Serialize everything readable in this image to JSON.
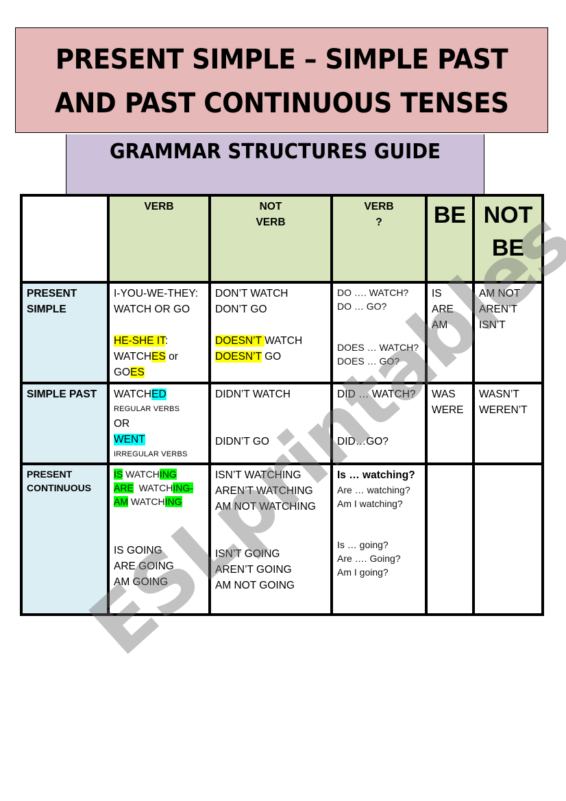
{
  "title": {
    "line1": "PRESENT SIMPLE – SIMPLE PAST",
    "line2": "AND PAST CONTINUOUS TENSES"
  },
  "subtitle": "GRAMMAR STRUCTURES GUIDE",
  "watermark": "ESLprintables.com",
  "colors": {
    "title_bg": "#e6b8b7",
    "subtitle_bg": "#ccc0da",
    "header_bg": "#d7e4bc",
    "row_label_bg": "#dbeef4",
    "highlight_yellow": "#ffff00",
    "highlight_cyan": "#00ffff",
    "highlight_green": "#00ff00"
  },
  "table": {
    "headers": [
      {
        "lines": [
          "VERB"
        ]
      },
      {
        "lines": [
          "NOT",
          "VERB"
        ]
      },
      {
        "lines": [
          "VERB",
          "?"
        ]
      },
      {
        "lines": [
          "BE"
        ]
      },
      {
        "lines": [
          "NOT",
          "BE"
        ]
      }
    ],
    "rows": [
      {
        "label": [
          "PRESENT",
          "SIMPLE"
        ],
        "verb": {
          "line1": "I-YOU-WE-THEY:",
          "line2": "WATCH OR GO",
          "he_she_it_hl": "HE-SHE IT",
          "he_she_it_rest": ":",
          "watches_base": "WATCH",
          "watches_hl": "ES",
          "watches_rest": " or",
          "goes_base": "GO",
          "goes_hl": "ES"
        },
        "not_verb": {
          "line1": "DON’T  WATCH",
          "line2": "DON’T GO",
          "doesnt1_hl": "DOESN’T ",
          "doesnt1_rest": " WATCH",
          "doesnt2_hl": "DOESN’T",
          "doesnt2_rest": " GO"
        },
        "verb_q": [
          "DO …. WATCH?",
          "DO … GO?",
          "DOES … WATCH?",
          "DOES … GO?"
        ],
        "be": [
          "IS",
          "ARE",
          "AM"
        ],
        "not_be": [
          "AM NOT",
          "AREN’T",
          "ISN’T"
        ]
      },
      {
        "label": [
          "SIMPLE PAST"
        ],
        "verb": {
          "watched_base": "WATCH",
          "watched_hl": "ED",
          "regular": "REGULAR VERBS",
          "or": "OR",
          "went_hl": "WENT",
          "irregular": "IRREGULAR VERBS"
        },
        "not_verb": [
          "DIDN’T WATCH",
          "DIDN’T GO"
        ],
        "verb_q": [
          "DID … WATCH?",
          "DID…GO?"
        ],
        "be": [
          "WAS",
          "WERE"
        ],
        "not_be": [
          "WASN’T",
          "WEREN’T"
        ]
      },
      {
        "label": [
          "PRESENT",
          "CONTINUOUS"
        ],
        "verb": {
          "is_hl": "IS",
          "is_mid": " WATCH",
          "is_end_hl": "ING",
          "are_hl": "ARE",
          "are_mid": "  WATCH",
          "are_end_hl": "ING-",
          "am_hl": "AM",
          "am_mid": " WATCH",
          "am_end_hl": "ING",
          "going": [
            "IS GOING",
            "ARE GOING",
            "AM GOING"
          ]
        },
        "not_verb": [
          "ISN’T WATCHING",
          "AREN’T WATCHING",
          "AM NOT WATCHING",
          "ISN’T GOING",
          "AREN’T GOING",
          "AM NOT GOING"
        ],
        "verb_q": [
          "Is … watching?",
          "Are … watching?",
          "Am I watching?",
          "Is … going?",
          "Are …. Going?",
          "Am I going?"
        ],
        "be": [],
        "not_be": []
      }
    ]
  }
}
